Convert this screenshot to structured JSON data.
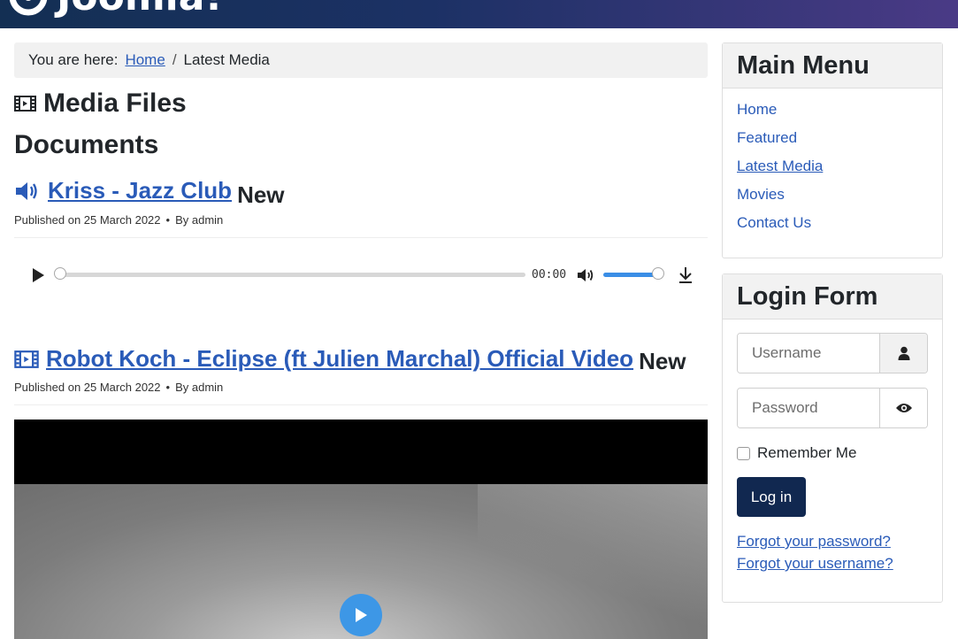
{
  "header": {
    "logo_text": "Joomla!"
  },
  "breadcrumb": {
    "prefix": "You are here:",
    "home": "Home",
    "separator": "/",
    "current": "Latest Media"
  },
  "page": {
    "title": "Media Files",
    "section": "Documents"
  },
  "items": [
    {
      "title": "Kriss - Jazz Club",
      "badge": "New",
      "published": "Published on 25 March 2022",
      "author": "By admin",
      "icon": "volume-icon"
    },
    {
      "title": "Robot Koch - Eclipse (ft Julien Marchal) Official Video",
      "badge": "New",
      "published": "Published on 25 March 2022",
      "author": "By admin",
      "icon": "film-icon"
    }
  ],
  "audio_player": {
    "time": "00:00",
    "progress": 0,
    "volume": 0.9
  },
  "main_menu": {
    "title": "Main Menu",
    "items": [
      {
        "label": "Home"
      },
      {
        "label": "Featured"
      },
      {
        "label": "Latest Media",
        "current": true
      },
      {
        "label": "Movies"
      },
      {
        "label": "Contact Us"
      }
    ]
  },
  "login_form": {
    "title": "Login Form",
    "username_placeholder": "Username",
    "password_placeholder": "Password",
    "remember_label": "Remember Me",
    "login_button": "Log in",
    "forgot_password": "Forgot your password?",
    "forgot_username": "Forgot your username?"
  },
  "colors": {
    "link": "#2a5bb8",
    "header_start": "#132f53",
    "header_end": "#4a3a86",
    "button": "#112850",
    "video_play": "#3d97e6"
  }
}
